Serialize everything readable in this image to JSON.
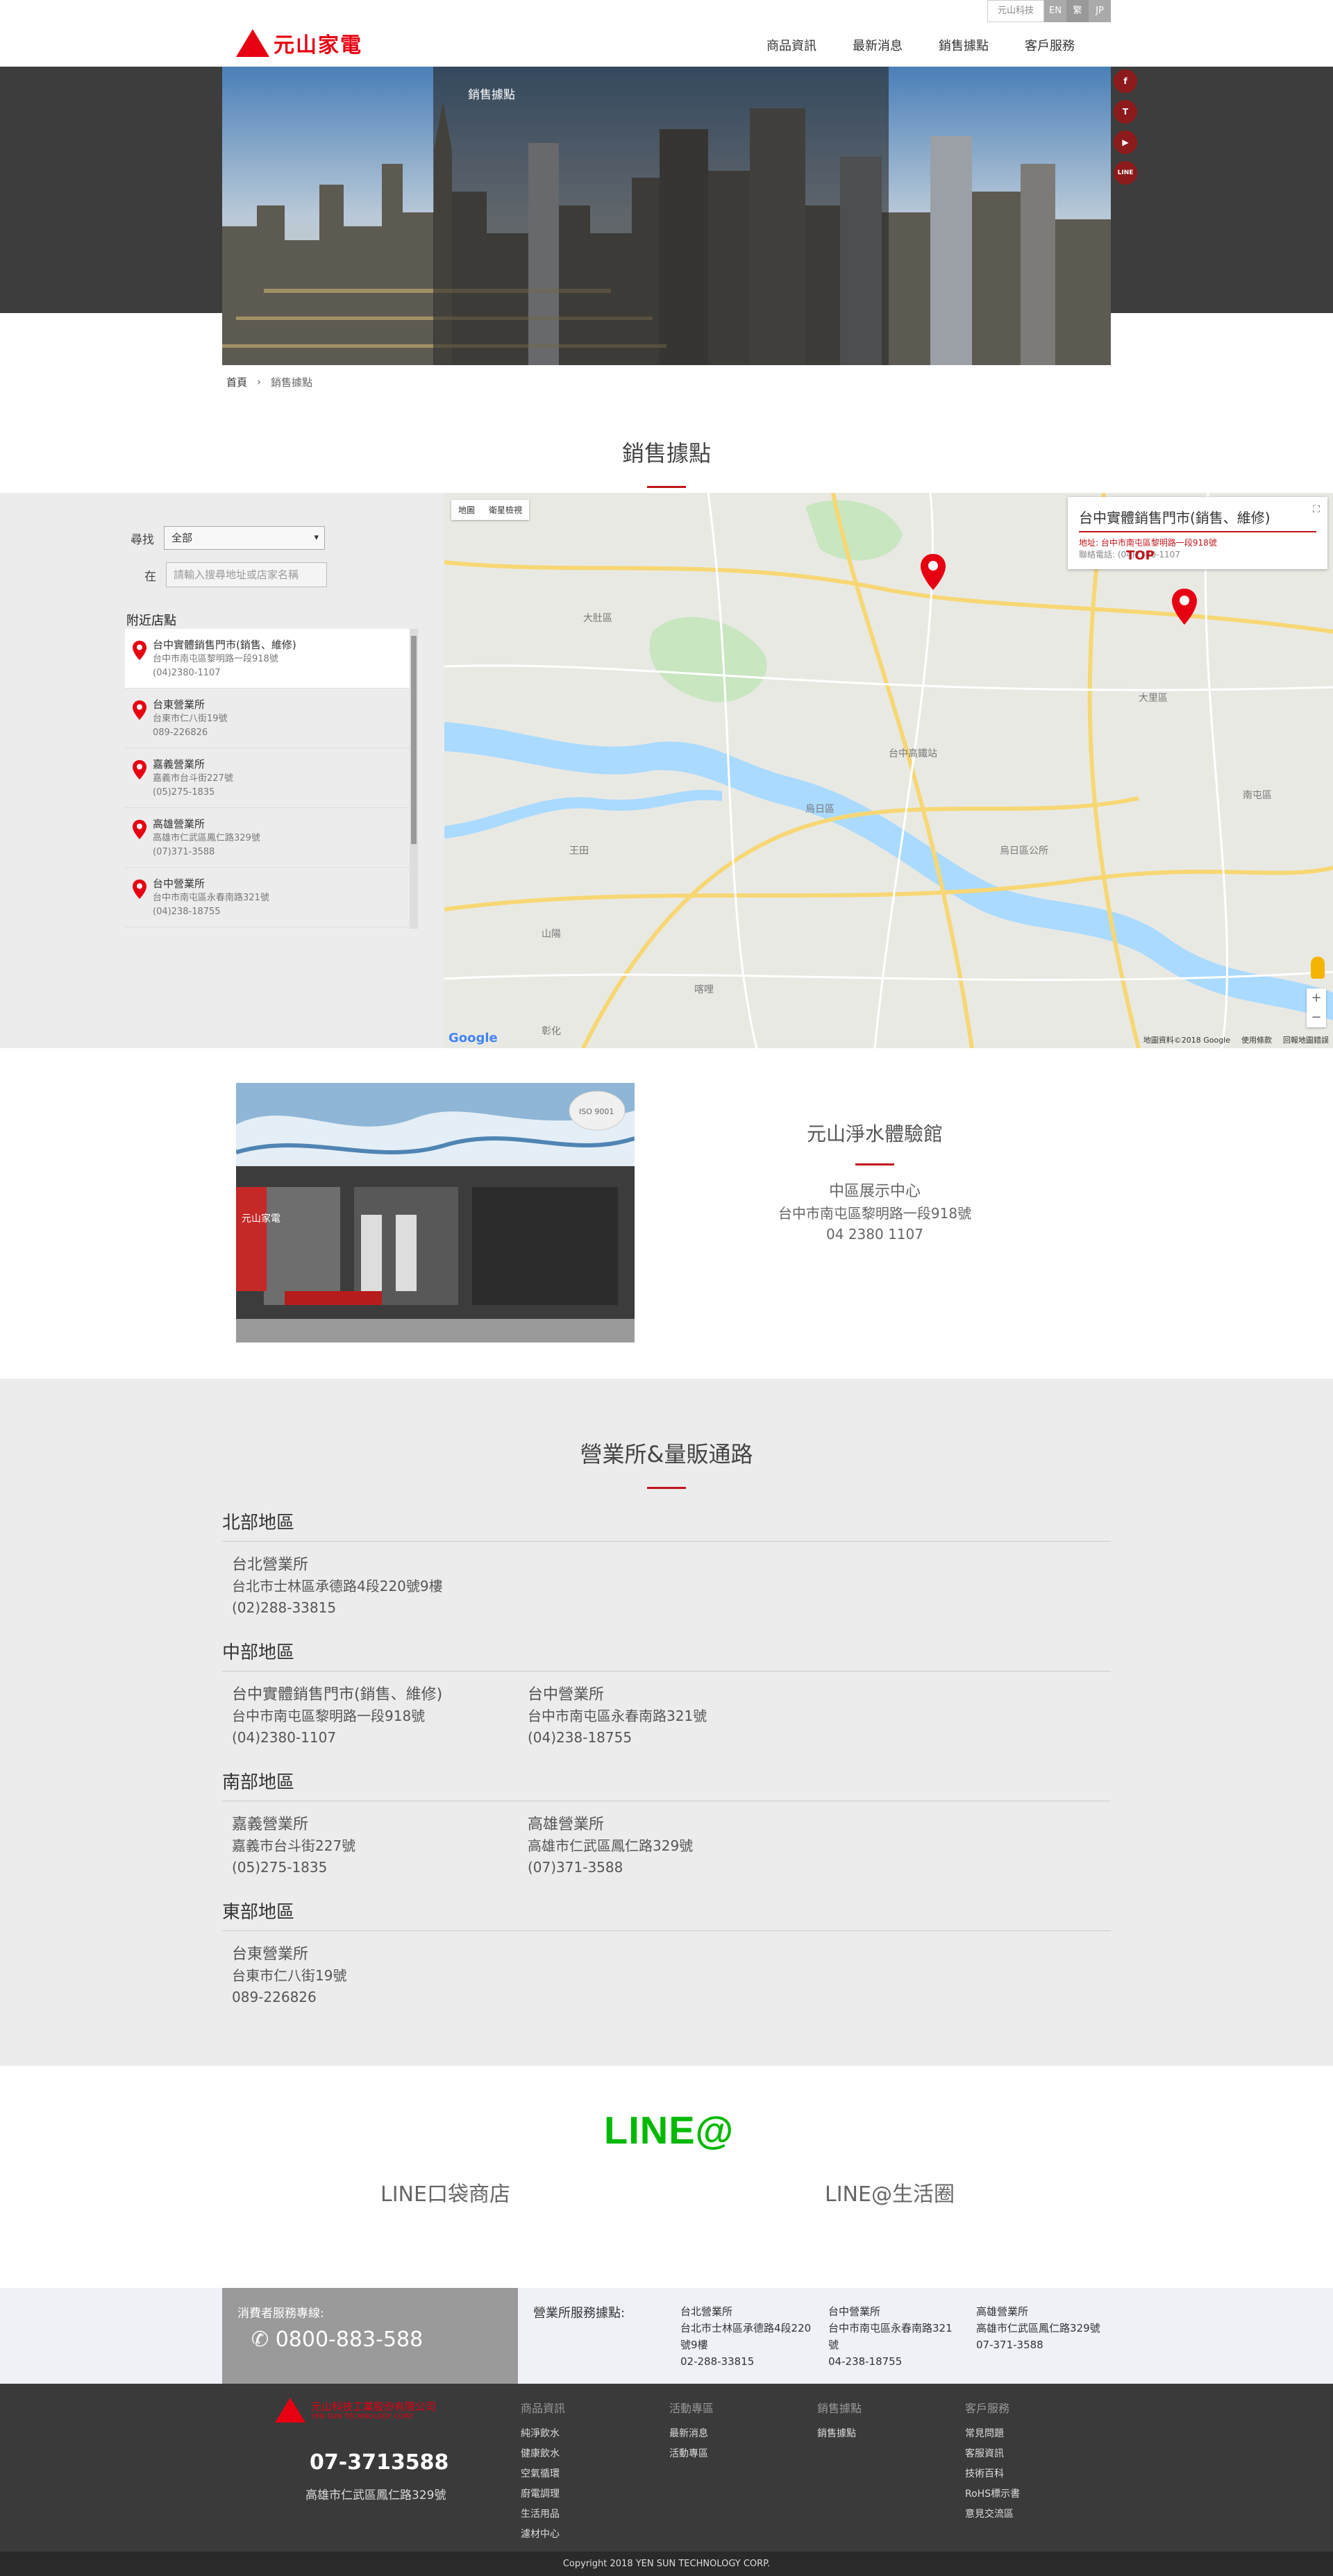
{
  "header": {
    "logo_text": "元山家電",
    "nav": [
      "商品資訊",
      "最新消息",
      "銷售據點",
      "客戶服務"
    ],
    "lang_brand": "元山科技",
    "langs": [
      "EN",
      "繁",
      "JP"
    ]
  },
  "banner": {
    "title": "銷售據點"
  },
  "social": [
    "f",
    "T",
    "▶",
    "LINE"
  ],
  "breadcrumb": {
    "home": "首頁",
    "sep": "›",
    "current": "銷售據點"
  },
  "locator": {
    "title": "銷售據點",
    "find_label": "尋找",
    "find_value": "全部",
    "at_label": "在",
    "search_placeholder": "請輸入搜尋地址或店家名稱",
    "nearby_title": "附近店點",
    "stores": [
      {
        "name": "台中實體銷售門市(銷售、維修)",
        "addr": "台中市南屯區黎明路一段918號",
        "phone": "(04)2380-1107"
      },
      {
        "name": "台東營業所",
        "addr": "台東市仁八街19號",
        "phone": "089-226826"
      },
      {
        "name": "嘉義營業所",
        "addr": "嘉義市台斗街227號",
        "phone": "(05)275-1835"
      },
      {
        "name": "高雄營業所",
        "addr": "高雄市仁武區鳳仁路329號",
        "phone": "(07)371-3588"
      },
      {
        "name": "台中營業所",
        "addr": "台中市南屯區永春南路321號",
        "phone": "(04)238-18755"
      }
    ]
  },
  "map": {
    "type_map": "地圖",
    "type_sat": "衛星檢視",
    "info_title": "台中實體銷售門市(銷售、維修)",
    "info_addr": "地址: 台中市南屯區黎明路一段918號",
    "info_phone": "聯絡電話: (04)2380-1107",
    "google": "Google",
    "footer": [
      "地圖資料©2018 Google",
      "使用條款",
      "回報地圖錯誤"
    ],
    "top": "TOP",
    "zoom_in": "+",
    "zoom_out": "−",
    "fullscreen": "⛶",
    "labels": {
      "l1": "大肚區",
      "l2": "烏日區",
      "l3": "大里區",
      "l4": "台中高鐵站",
      "l5": "烏日區公所",
      "l6": "南屯區",
      "l7": "王田",
      "l8": "山陽",
      "l9": "喀哩",
      "l10": "彰化"
    }
  },
  "showroom": {
    "title": "元山淨水體驗館",
    "name": "中區展示中心",
    "addr": "台中市南屯區黎明路一段918號",
    "phone": "04 2380 1107",
    "sign": "元山家電",
    "iso": "ISO 9001"
  },
  "branches": {
    "title": "營業所&量販通路",
    "regions": [
      {
        "name": "北部地區",
        "items": [
          {
            "n": "台北營業所",
            "a": "台北市士林區承德路4段220號9樓",
            "p": "(02)288-33815"
          }
        ]
      },
      {
        "name": "中部地區",
        "items": [
          {
            "n": "台中實體銷售門市(銷售、維修)",
            "a": "台中市南屯區黎明路一段918號",
            "p": "(04)2380-1107"
          },
          {
            "n": "台中營業所",
            "a": "台中市南屯區永春南路321號",
            "p": "(04)238-18755"
          }
        ]
      },
      {
        "name": "南部地區",
        "items": [
          {
            "n": "嘉義營業所",
            "a": "嘉義市台斗街227號",
            "p": "(05)275-1835"
          },
          {
            "n": "高雄營業所",
            "a": "高雄市仁武區鳳仁路329號",
            "p": "(07)371-3588"
          }
        ]
      },
      {
        "name": "東部地區",
        "items": [
          {
            "n": "台東營業所",
            "a": "台東市仁八街19號",
            "p": "089-226826"
          }
        ]
      }
    ]
  },
  "line": {
    "logo": "LINE@",
    "link1": "LINE口袋商店",
    "link2": "LINE@生活圈"
  },
  "contact": {
    "hotline_label": "消費者服務專線:",
    "hotline_number": "0800-883-588",
    "service_label": "營業所服務據點:",
    "offices": [
      {
        "n": "台北營業所",
        "a": "台北市士林區承德路4段220號9樓",
        "p": "02-288-33815"
      },
      {
        "n": "台中營業所",
        "a": "台中市南屯區永春南路321號",
        "p": "04-238-18755"
      },
      {
        "n": "高雄營業所",
        "a": "高雄市仁武區鳳仁路329號",
        "p": "07-371-3588"
      }
    ]
  },
  "footer": {
    "company_cn": "元山科技工業股份有限公司",
    "company_en": "YEN SUN TECHNOLOGY CORP.",
    "phone": "07-3713588",
    "addr": "高雄市仁武區鳳仁路329號",
    "cols": [
      {
        "h": "商品資訊",
        "items": [
          "純淨飲水",
          "健康飲水",
          "空氣循環",
          "廚電調理",
          "生活用品",
          "濾材中心"
        ]
      },
      {
        "h": "活動專區",
        "items": [
          "最新消息",
          "活動專區"
        ]
      },
      {
        "h": "銷售據點",
        "items": [
          "銷售據點"
        ]
      },
      {
        "h": "客戶服務",
        "items": [
          "常見問題",
          "客服資訊",
          "技術百科",
          "RoHS標示書",
          "意見交流區"
        ]
      }
    ],
    "copyright": "Copyright 2018 YEN SUN TECHNOLOGY CORP."
  },
  "colors": {
    "brand_red": "#e60012",
    "accent_red": "#c0141b",
    "line_green": "#00b900"
  }
}
